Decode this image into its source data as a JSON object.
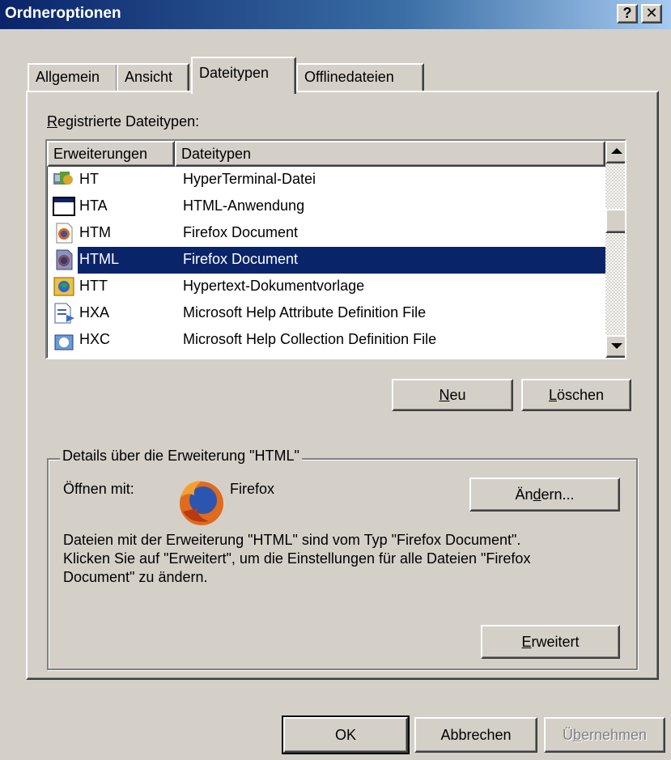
{
  "window": {
    "title": "Ordneroptionen",
    "help_label": "?",
    "close_label": "✕"
  },
  "tabs": [
    {
      "label": "Allgemein"
    },
    {
      "label": "Ansicht"
    },
    {
      "label": "Dateitypen",
      "active": true
    },
    {
      "label": "Offlinedateien"
    }
  ],
  "registered": {
    "label_first": "R",
    "label_rest": "egistrierte Dateitypen:"
  },
  "list": {
    "columns": [
      "Erweiterungen",
      "Dateitypen"
    ],
    "rows": [
      {
        "ext": "HT",
        "type": "HyperTerminal-Datei",
        "icon": "hyperterminal-icon"
      },
      {
        "ext": "HTA",
        "type": "HTML-Anwendung",
        "icon": "application-window-icon"
      },
      {
        "ext": "HTM",
        "type": "Firefox Document",
        "icon": "firefox-document-icon"
      },
      {
        "ext": "HTML",
        "type": "Firefox Document",
        "icon": "firefox-document-icon",
        "selected": true
      },
      {
        "ext": "HTT",
        "type": "Hypertext-Dokumentvorlage",
        "icon": "hypertext-template-icon"
      },
      {
        "ext": "HXA",
        "type": "Microsoft Help Attribute Definition File",
        "icon": "help-file-icon"
      },
      {
        "ext": "HXC",
        "type": "Microsoft Help Collection Definition File",
        "icon": "help-collection-icon"
      }
    ]
  },
  "buttons": {
    "new_first": "N",
    "new_rest": "eu",
    "delete_first": "L",
    "delete_rest": "öschen",
    "change_pre": "Än",
    "change_ul": "d",
    "change_post": "ern...",
    "advanced_first": "E",
    "advanced_rest": "rweitert",
    "ok": "OK",
    "cancel": "Abbrechen",
    "apply_pre": "Ü",
    "apply_ul": "b",
    "apply_post": "ernehmen"
  },
  "details": {
    "legend": "Details über die Erweiterung \"HTML\"",
    "open_with_label": "Öffnen mit:",
    "program_name": "Firefox",
    "description_line1": "Dateien mit der Erweiterung \"HTML\" sind vom Typ \"Firefox Document\".",
    "description_line2": "Klicken Sie auf \"Erweitert\", um die Einstellungen für alle Dateien \"Firefox",
    "description_line3": "Document\" zu ändern."
  },
  "colors": {
    "selection": "#0a246a",
    "face": "#d4d0c8"
  }
}
